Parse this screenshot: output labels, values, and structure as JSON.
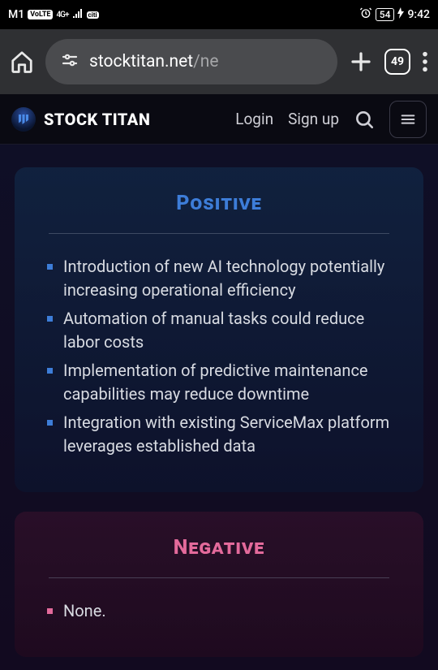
{
  "status": {
    "carrier": "M1",
    "volte": "VoLTE",
    "net_label": "4G+",
    "citi": "citi",
    "battery": "54",
    "time": "9:42"
  },
  "browser": {
    "url_host": "stocktitan.net",
    "url_path": "/ne",
    "tab_count": "49"
  },
  "site": {
    "brand": "STOCK TITAN",
    "login": "Login",
    "signup": "Sign up"
  },
  "positive": {
    "title": "Positive",
    "items": [
      "Introduction of new AI technology potentially increasing operational efficiency",
      "Automation of manual tasks could reduce labor costs",
      "Implementation of predictive maintenance capabilities may reduce downtime",
      "Integration with existing ServiceMax platform leverages established data"
    ]
  },
  "negative": {
    "title": "Negative",
    "items": [
      "None."
    ]
  }
}
